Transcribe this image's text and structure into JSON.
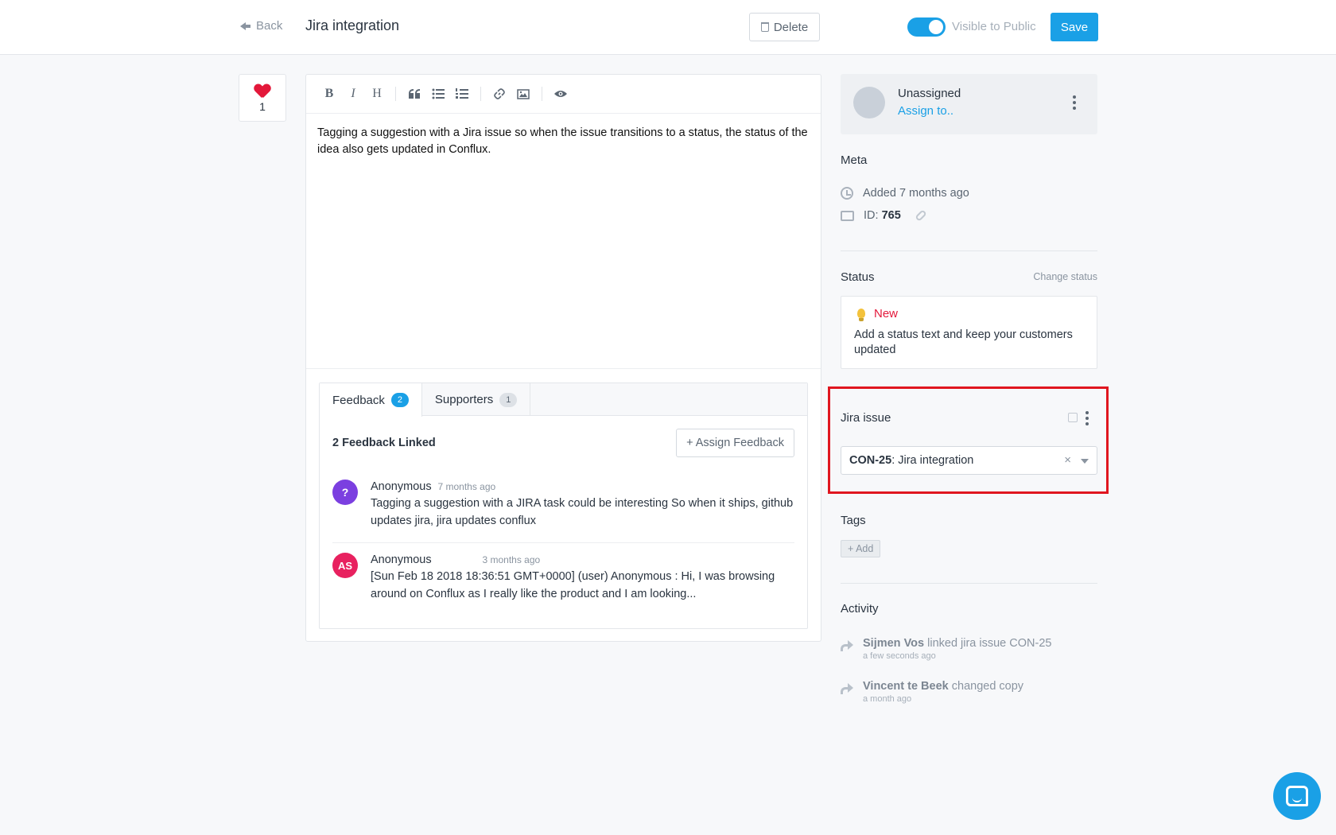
{
  "header": {
    "back_label": "Back",
    "title": "Jira integration",
    "delete_label": "Delete",
    "visible_label": "Visible to Public",
    "visible_on": true,
    "save_label": "Save"
  },
  "vote": {
    "count": "1"
  },
  "editor": {
    "toolbar": [
      "B",
      "I",
      "H",
      "quote-icon",
      "bullet-list-icon",
      "numbered-list-icon",
      "link-icon",
      "image-icon",
      "preview-icon"
    ],
    "text": "Tagging a suggestion with a Jira issue so when the issue transitions to a status, the status of the idea also gets updated in Conflux."
  },
  "feedback": {
    "tabs": [
      {
        "label": "Feedback",
        "count": "2"
      },
      {
        "label": "Supporters",
        "count": "1"
      }
    ],
    "linked_count": "2 Feedback Linked",
    "assign_label": "+ Assign Feedback",
    "items": [
      {
        "avatar": "?",
        "name": "Anonymous",
        "time": "7 months ago",
        "text": "Tagging a suggestion with a JIRA task could be interesting So when it ships, github updates jira, jira updates conflux"
      },
      {
        "avatar": "AS",
        "name": "Anonymous",
        "time": "3 months ago",
        "text": "[Sun Feb 18 2018 18:36:51 GMT+0000] (user)  Anonymous            : Hi, I was browsing around on Conflux as I really like the product and I am looking..."
      }
    ]
  },
  "assignee": {
    "name": "Unassigned",
    "assign_link": "Assign to.."
  },
  "meta": {
    "title": "Meta",
    "added": "Added 7 months ago",
    "id_label": "ID:",
    "id_value": "765"
  },
  "status": {
    "title": "Status",
    "change_label": "Change status",
    "name": "New",
    "description": "Add a status text and keep your customers updated"
  },
  "jira": {
    "title": "Jira issue",
    "key": "CON-25",
    "summary": ": Jira integration",
    "clear": "×"
  },
  "tags": {
    "title": "Tags",
    "add_label": "+ Add"
  },
  "activity": {
    "title": "Activity",
    "items": [
      {
        "actor": "Sijmen Vos",
        "action": " linked jira issue CON-25",
        "time": "a few seconds ago"
      },
      {
        "actor": "Vincent te Beek",
        "action": " changed copy",
        "time": "a month ago"
      }
    ]
  },
  "colors": {
    "accent": "#1aa0e6",
    "status_new": "#e3183a",
    "highlight": "#e0161f"
  }
}
